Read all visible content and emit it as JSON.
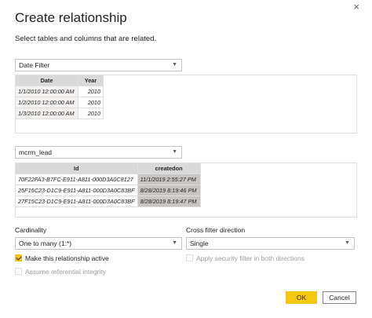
{
  "dialog": {
    "title": "Create relationship",
    "subtitle": "Select tables and columns that are related.",
    "close_glyph": "×"
  },
  "table1": {
    "selected": "Date Filter",
    "columns": [
      "Date",
      "Year"
    ],
    "rows": [
      [
        "1/1/2010 12:00:00 AM",
        "2010"
      ],
      [
        "1/2/2010 12:00:00 AM",
        "2010"
      ],
      [
        "1/3/2010 12:00:00 AM",
        "2010"
      ]
    ]
  },
  "table2": {
    "selected": "mcrm_lead",
    "columns": [
      "Id",
      "createdon"
    ],
    "rows": [
      [
        "70F22FA3-B7FC-E911-A811-000D3A0C8127",
        "11/1/2019 2:55:27 PM"
      ],
      [
        "25F15C23-D1C9-E911-A811-000D3A0C83BF",
        "8/28/2019 8:19:46 PM"
      ],
      [
        "27F15C23-D1C9-E911-A811-000D3A0C83BF",
        "8/28/2019 8:19:47 PM"
      ]
    ]
  },
  "cardinality": {
    "label": "Cardinality",
    "selected": "One to many (1:*)"
  },
  "cross_filter": {
    "label": "Cross filter direction",
    "selected": "Single"
  },
  "options": {
    "active_label": "Make this relationship active",
    "active_checked": true,
    "security_label": "Apply security filter in both directions",
    "referential_label": "Assume referential integrity"
  },
  "buttons": {
    "ok": "OK",
    "cancel": "Cancel"
  },
  "icons": {
    "dropdown": "chevron-down-icon",
    "close": "close-icon"
  }
}
